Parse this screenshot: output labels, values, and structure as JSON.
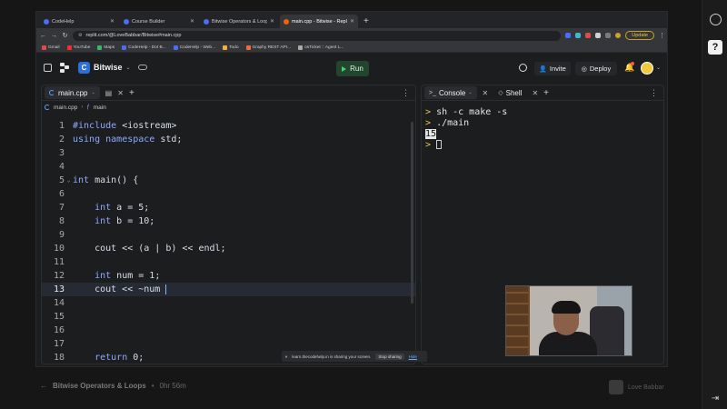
{
  "browser": {
    "tabs": [
      {
        "title": "CodeHelp",
        "active": false
      },
      {
        "title": "Course Builder",
        "active": false
      },
      {
        "title": "Bitwise Operators & Loops",
        "active": false
      },
      {
        "title": "main.cpp - Bitwise - Replit",
        "active": true
      }
    ],
    "new_tab": "+",
    "url": "replit.com/@LoveBabbar/Bitwise#main.cpp",
    "update_label": "Update",
    "bookmarks": [
      "Gmail",
      "YouTube",
      "Maps",
      "CodeHelp - Dot B...",
      "CodeHelp - Web...",
      "Todo",
      "Graphy REST API...",
      "osTicket :: Agent L..."
    ]
  },
  "replit": {
    "project_letter": "C",
    "project_name": "Bitwise",
    "run_label": "Run",
    "invite_label": "Invite",
    "deploy_label": "Deploy"
  },
  "editor": {
    "tab_label": "main.cpp",
    "breadcrumb_file": "main.cpp",
    "breadcrumb_symbol": "main",
    "lines": [
      {
        "n": "1",
        "code": "#include <iostream>"
      },
      {
        "n": "2",
        "code": "using namespace std;"
      },
      {
        "n": "3",
        "code": ""
      },
      {
        "n": "4",
        "code": ""
      },
      {
        "n": "5",
        "code": "int main() {"
      },
      {
        "n": "6",
        "code": ""
      },
      {
        "n": "7",
        "code": "    int a = 5;"
      },
      {
        "n": "8",
        "code": "    int b = 10;"
      },
      {
        "n": "9",
        "code": ""
      },
      {
        "n": "10",
        "code": "    cout << (a | b) << endl;"
      },
      {
        "n": "11",
        "code": ""
      },
      {
        "n": "12",
        "code": "    int num = 1;"
      },
      {
        "n": "13",
        "code": "    cout << ~num "
      },
      {
        "n": "14",
        "code": ""
      },
      {
        "n": "15",
        "code": ""
      },
      {
        "n": "16",
        "code": ""
      },
      {
        "n": "17",
        "code": ""
      },
      {
        "n": "18",
        "code": "    return 0;"
      }
    ]
  },
  "console": {
    "tab_console": "Console",
    "tab_shell": "Shell",
    "cmd1": "sh -c make -s",
    "cmd2": "./main",
    "output": "15",
    "prompt": ">"
  },
  "sharebar": {
    "text": "learn.thecodehelp.in is sharing your screen.",
    "stop": "Stop sharing",
    "hide": "Hide"
  },
  "lesson": {
    "title": "Bitwise Operators & Loops",
    "duration": "0hr 56m"
  },
  "author": {
    "name": "Love Babbar"
  },
  "icons": {
    "back": "←",
    "forward": "→",
    "reload": "↻",
    "kebab": "⋮",
    "bell": "🔔"
  }
}
